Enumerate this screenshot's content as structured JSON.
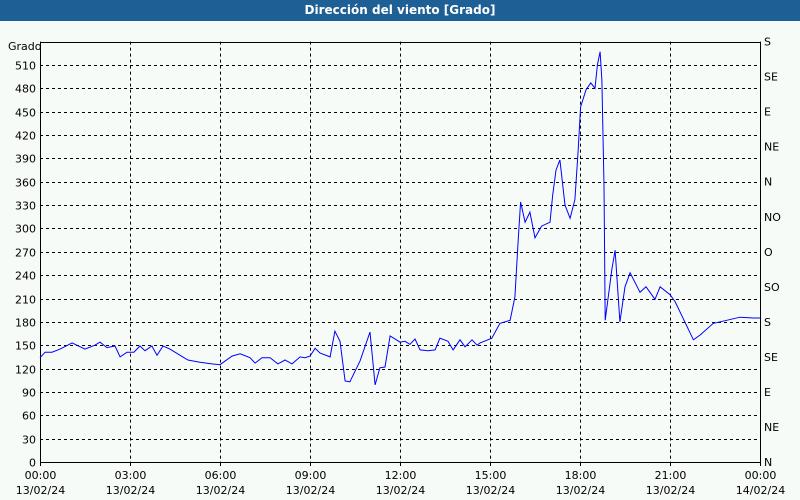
{
  "chart_data": {
    "type": "line",
    "title": "Dirección del viento [Grado]",
    "ylabel": "Grado",
    "ylim": [
      0,
      540
    ],
    "yticks": [
      0,
      30,
      60,
      90,
      120,
      150,
      180,
      210,
      240,
      270,
      300,
      330,
      360,
      390,
      420,
      450,
      480,
      510
    ],
    "right_ticks": [
      {
        "value": 540,
        "label": "S"
      },
      {
        "value": 495,
        "label": "SE"
      },
      {
        "value": 450,
        "label": "E"
      },
      {
        "value": 405,
        "label": "NE"
      },
      {
        "value": 360,
        "label": "N"
      },
      {
        "value": 315,
        "label": "NO"
      },
      {
        "value": 270,
        "label": "O"
      },
      {
        "value": 225,
        "label": "SO"
      },
      {
        "value": 180,
        "label": "S"
      },
      {
        "value": 135,
        "label": "SE"
      },
      {
        "value": 90,
        "label": "E"
      },
      {
        "value": 45,
        "label": "NE"
      },
      {
        "value": 0,
        "label": "N"
      }
    ],
    "xlim_hours": [
      0,
      24
    ],
    "xticks": [
      {
        "hour": 0,
        "time": "00:00",
        "date": "13/02/24"
      },
      {
        "hour": 3,
        "time": "03:00",
        "date": "13/02/24"
      },
      {
        "hour": 6,
        "time": "06:00",
        "date": "13/02/24"
      },
      {
        "hour": 9,
        "time": "09:00",
        "date": "13/02/24"
      },
      {
        "hour": 12,
        "time": "12:00",
        "date": "13/02/24"
      },
      {
        "hour": 15,
        "time": "15:00",
        "date": "13/02/24"
      },
      {
        "hour": 18,
        "time": "18:00",
        "date": "13/02/24"
      },
      {
        "hour": 21,
        "time": "21:00",
        "date": "13/02/24"
      },
      {
        "hour": 24,
        "time": "00:00",
        "date": "14/02/24"
      }
    ],
    "grid": true,
    "series": [
      {
        "name": "Dirección del viento",
        "color": "#0000ff",
        "points": [
          [
            0,
            134
          ],
          [
            0.17,
            141
          ],
          [
            0.4,
            141
          ],
          [
            0.67,
            145
          ],
          [
            1.07,
            153
          ],
          [
            1.5,
            145
          ],
          [
            1.83,
            150
          ],
          [
            2,
            154
          ],
          [
            2.23,
            147
          ],
          [
            2.5,
            149
          ],
          [
            2.67,
            135
          ],
          [
            2.9,
            141
          ],
          [
            3.13,
            141
          ],
          [
            3.33,
            149
          ],
          [
            3.5,
            143
          ],
          [
            3.73,
            149
          ],
          [
            3.9,
            137
          ],
          [
            4.1,
            149
          ],
          [
            4.33,
            145
          ],
          [
            4.67,
            137
          ],
          [
            4.93,
            131
          ],
          [
            5.33,
            128
          ],
          [
            5.73,
            126
          ],
          [
            6,
            125
          ],
          [
            6.4,
            136
          ],
          [
            6.67,
            139
          ],
          [
            7,
            134
          ],
          [
            7.17,
            127
          ],
          [
            7.4,
            134
          ],
          [
            7.67,
            134
          ],
          [
            7.93,
            126
          ],
          [
            8.17,
            131
          ],
          [
            8.4,
            126
          ],
          [
            8.67,
            135
          ],
          [
            8.83,
            134
          ],
          [
            9,
            136
          ],
          [
            9.17,
            146
          ],
          [
            9.33,
            140
          ],
          [
            9.67,
            135
          ],
          [
            9.83,
            168
          ],
          [
            10,
            155
          ],
          [
            10.17,
            104
          ],
          [
            10.33,
            103
          ],
          [
            10.67,
            130
          ],
          [
            11,
            167
          ],
          [
            11.17,
            99
          ],
          [
            11.33,
            121
          ],
          [
            11.5,
            122
          ],
          [
            11.67,
            162
          ],
          [
            12,
            154
          ],
          [
            12.17,
            155
          ],
          [
            12.33,
            151
          ],
          [
            12.5,
            158
          ],
          [
            12.67,
            144
          ],
          [
            12.93,
            143
          ],
          [
            13.17,
            144
          ],
          [
            13.33,
            159
          ],
          [
            13.6,
            155
          ],
          [
            13.77,
            144
          ],
          [
            14,
            157
          ],
          [
            14.17,
            148
          ],
          [
            14.4,
            157
          ],
          [
            14.57,
            150
          ],
          [
            14.67,
            153
          ],
          [
            15.06,
            159
          ],
          [
            15.33,
            178
          ],
          [
            15.67,
            182
          ],
          [
            15.83,
            212
          ],
          [
            15.94,
            285
          ],
          [
            16.02,
            334
          ],
          [
            16.17,
            308
          ],
          [
            16.33,
            321
          ],
          [
            16.5,
            288
          ],
          [
            16.72,
            303
          ],
          [
            17,
            308
          ],
          [
            17.09,
            343
          ],
          [
            17.2,
            375
          ],
          [
            17.33,
            388
          ],
          [
            17.5,
            330
          ],
          [
            17.67,
            313
          ],
          [
            17.83,
            337
          ],
          [
            17.94,
            401
          ],
          [
            18.02,
            456
          ],
          [
            18.2,
            478
          ],
          [
            18.36,
            487
          ],
          [
            18.5,
            480
          ],
          [
            18.58,
            510
          ],
          [
            18.67,
            527
          ],
          [
            18.73,
            490
          ],
          [
            18.8,
            355
          ],
          [
            18.84,
            182
          ],
          [
            19.06,
            247
          ],
          [
            19.17,
            272
          ],
          [
            19.33,
            180
          ],
          [
            19.5,
            225
          ],
          [
            19.67,
            243
          ],
          [
            20,
            218
          ],
          [
            20.2,
            225
          ],
          [
            20.5,
            209
          ],
          [
            20.67,
            225
          ],
          [
            21,
            215
          ],
          [
            21.17,
            206
          ],
          [
            21.78,
            157
          ],
          [
            22,
            163
          ],
          [
            22.44,
            178
          ],
          [
            22.89,
            182
          ],
          [
            23.33,
            186
          ],
          [
            23.78,
            185
          ],
          [
            24,
            185
          ]
        ]
      }
    ]
  }
}
